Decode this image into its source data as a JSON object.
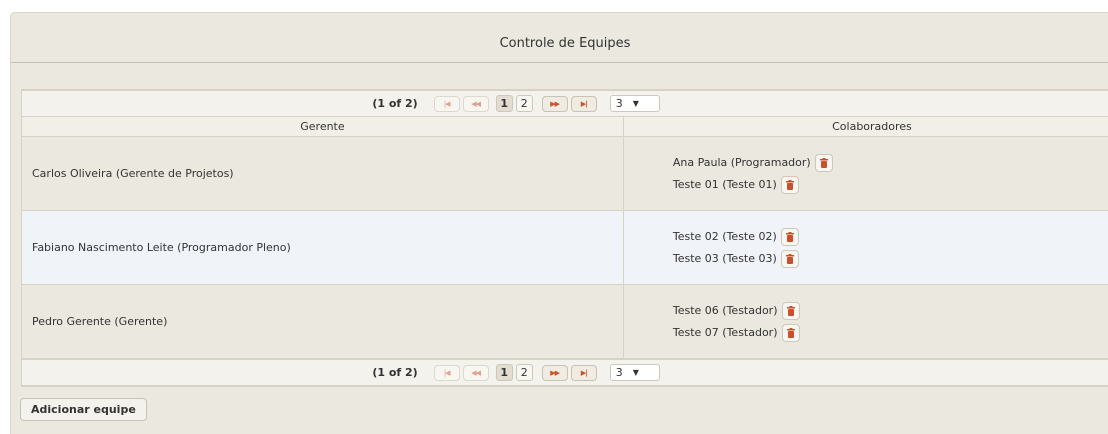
{
  "panel": {
    "title": "Controle de Equipes"
  },
  "paginator": {
    "current": "(1 of 2)",
    "first_icon": "first-page-icon",
    "prev_icon": "prev-page-icon",
    "next_icon": "next-page-icon",
    "last_icon": "last-page-icon",
    "pages": [
      "1",
      "2"
    ],
    "selected_page": "1",
    "rows_per_page": "3"
  },
  "table": {
    "columns": [
      "Gerente",
      "Colaboradores"
    ],
    "rows": [
      {
        "gerente": "Carlos Oliveira (Gerente de Projetos)",
        "colaboradores": [
          "Ana Paula (Programador)",
          "Teste 01 (Teste 01)"
        ]
      },
      {
        "gerente": "Fabiano Nascimento Leite (Programador Pleno)",
        "colaboradores": [
          "Teste 02 (Teste 02)",
          "Teste 03 (Teste 03)"
        ]
      },
      {
        "gerente": "Pedro Gerente (Gerente)",
        "colaboradores": [
          "Teste 06 (Testador)",
          "Teste 07 (Testador)"
        ]
      }
    ]
  },
  "actions": {
    "add_label": "Adicionar equipe"
  },
  "colors": {
    "trash_icon": "#c8502c",
    "panel_bg": "#ebe8df",
    "alt_row_bg": "#f0f3f8"
  }
}
